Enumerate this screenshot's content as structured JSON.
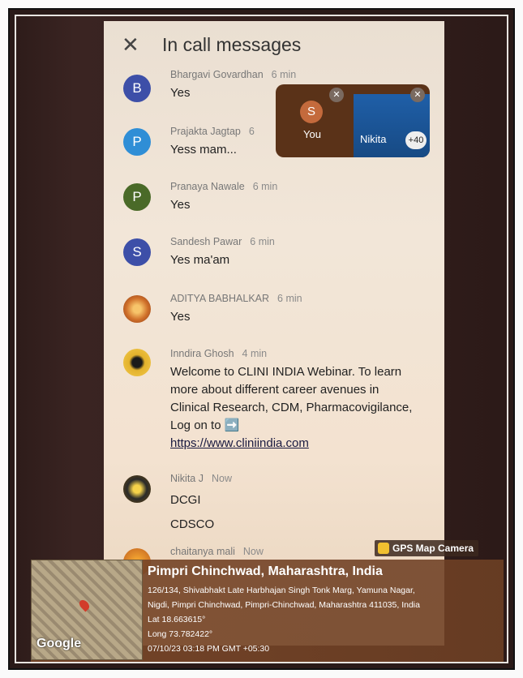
{
  "header": {
    "close_icon": "close-icon",
    "title": "In call messages"
  },
  "messages": [
    {
      "avatar": "B",
      "name": "Bhargavi Govardhan",
      "time": "6 min",
      "text": "Yes"
    },
    {
      "avatar": "P",
      "name": "Prajakta Jagtap",
      "time": "6",
      "text": "Yess mam..."
    },
    {
      "avatar": "P",
      "name": "Pranaya Nawale",
      "time": "6 min",
      "text": "Yes"
    },
    {
      "avatar": "S",
      "name": "Sandesh Pawar",
      "time": "6 min",
      "text": "Yes ma'am"
    },
    {
      "avatar": "",
      "name": "ADITYA BABHALKAR",
      "time": "6 min",
      "text": "Yes"
    },
    {
      "avatar": "",
      "name": "Inndira Ghosh",
      "time": "4 min",
      "text": "Welcome to CLINI INDIA Webinar. To learn more about different career avenues in Clinical Research, CDM, Pharmacovigilance, Log on to ➡️",
      "link": "https://www.cliniindia.com"
    },
    {
      "avatar": "",
      "name": "Nikita J",
      "time": "Now",
      "text_lines": [
        "DCGI",
        "CDSCO"
      ]
    },
    {
      "avatar": "",
      "name": "chaitanya mali",
      "time": "Now",
      "text": ""
    }
  ],
  "pip": {
    "you_avatar": "S",
    "you_label": "You",
    "other_label": "Nikita",
    "count": "+40"
  },
  "stamp": {
    "badge": "GPS Map Camera",
    "title": "Pimpri Chinchwad, Maharashtra, India",
    "address1": "126/134, Shivabhakt Late Harbhajan Singh Tonk Marg, Yamuna Nagar,",
    "address2": "Nigdi, Pimpri Chinchwad, Pimpri-Chinchwad, Maharashtra 411035, India",
    "lat": "Lat 18.663615°",
    "long": "Long 73.782422°",
    "datetime": "07/10/23 03:18 PM GMT +05:30",
    "map_label": "Google"
  }
}
